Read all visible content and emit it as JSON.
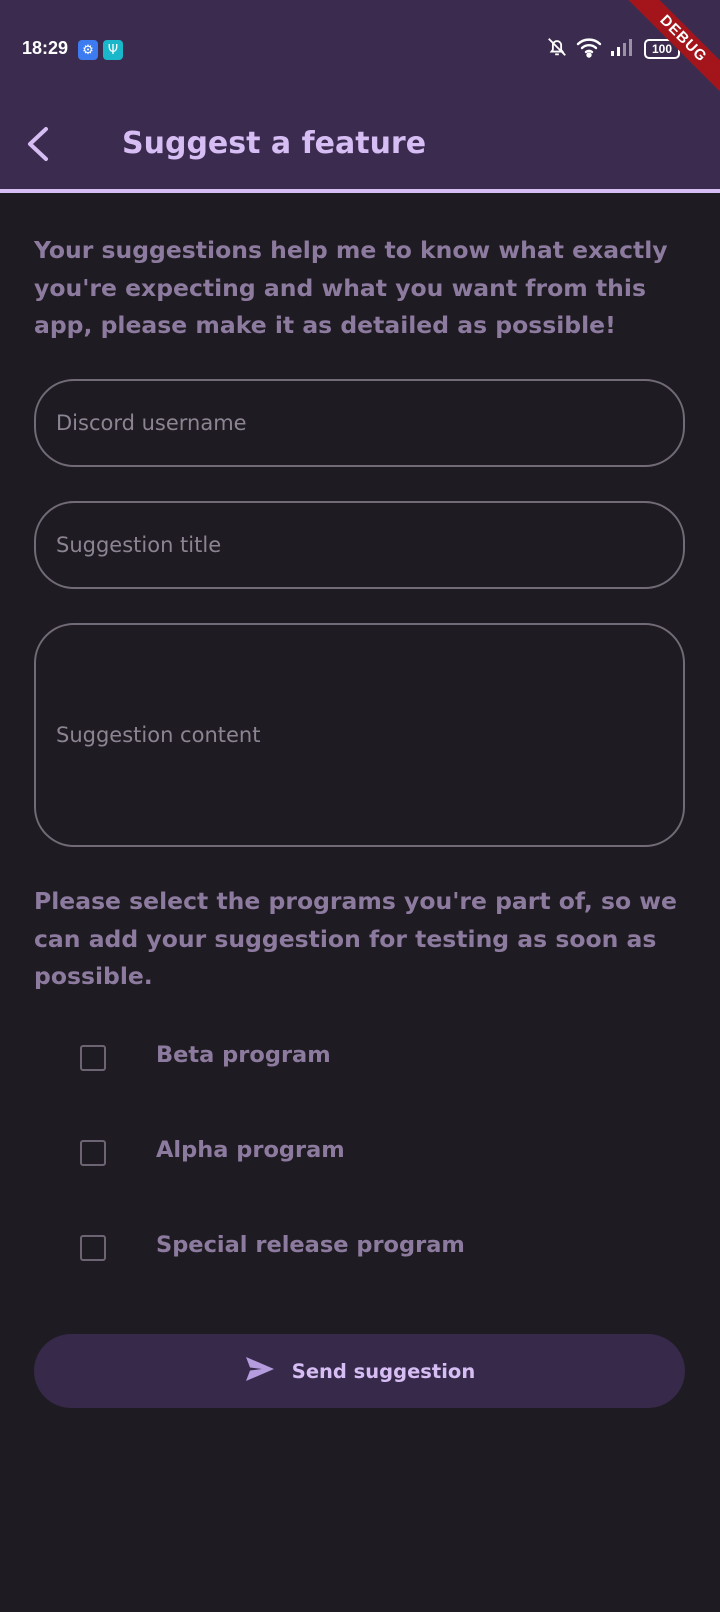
{
  "status_bar": {
    "time": "18:29",
    "battery": "100",
    "icons": [
      "settings-icon",
      "usb-icon",
      "bell-off-icon",
      "wifi-icon",
      "signal-icon",
      "battery-icon"
    ]
  },
  "debug_banner": "DEBUG",
  "header": {
    "title": "Suggest a feature",
    "back_icon": "chevron-left-icon"
  },
  "intro_text": "Your suggestions help me to know what exactly you're expecting and what you want from this app, please make it as detailed as possible!",
  "fields": {
    "discord_username": {
      "placeholder": "Discord username",
      "value": ""
    },
    "suggestion_title": {
      "placeholder": "Suggestion title",
      "value": ""
    },
    "suggestion_content": {
      "placeholder": "Suggestion content",
      "value": ""
    }
  },
  "programs_text": "Please select the programs you're part of, so we can add your suggestion for testing as soon as possible.",
  "programs": [
    {
      "label": "Beta program",
      "checked": false
    },
    {
      "label": "Alpha program",
      "checked": false
    },
    {
      "label": "Special release program",
      "checked": false
    }
  ],
  "send_button": {
    "label": "Send suggestion",
    "icon": "send-icon"
  },
  "colors": {
    "background": "#1f1b22",
    "app_bar": "#3b2c4f",
    "accent": "#d6bdf3",
    "muted_text": "#8d7b9f",
    "button": "#36294a"
  }
}
